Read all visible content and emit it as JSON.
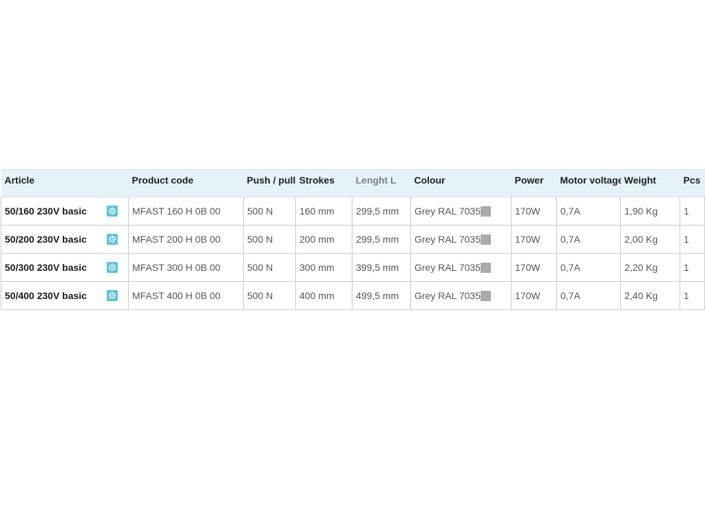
{
  "table": {
    "headers": {
      "article": "Article",
      "product_code": "Product code",
      "push_pull": "Push / pull",
      "strokes": "Strokes",
      "length": "Lenght L",
      "colour": "Colour",
      "power": "Power",
      "motor_voltage": "Motor voltage",
      "weight": "Weight",
      "pcs": "Pcs"
    },
    "swatch_color": "#aaaaaa",
    "icon_color": "#5bc3d8",
    "row_icon": "configurator-icon",
    "rows": [
      {
        "article": "50/160 230V basic",
        "product_code": "MFAST 160 H 0B 00",
        "push_pull": "500 N",
        "strokes": "160 mm",
        "length": "299,5 mm",
        "colour": "Grey RAL 7035",
        "power": "170W",
        "motor_voltage": "0,7A",
        "weight": "1,90 Kg",
        "pcs": "1"
      },
      {
        "article": "50/200 230V basic",
        "product_code": "MFAST 200 H 0B 00",
        "push_pull": "500 N",
        "strokes": "200 mm",
        "length": "299,5 mm",
        "colour": "Grey RAL 7035",
        "power": "170W",
        "motor_voltage": "0,7A",
        "weight": "2,00 Kg",
        "pcs": "1"
      },
      {
        "article": "50/300 230V basic",
        "product_code": "MFAST 300 H 0B 00",
        "push_pull": "500 N",
        "strokes": "300 mm",
        "length": "399,5 mm",
        "colour": "Grey RAL 7035",
        "power": "170W",
        "motor_voltage": "0,7A",
        "weight": "2,20 Kg",
        "pcs": "1"
      },
      {
        "article": "50/400 230V basic",
        "product_code": "MFAST 400 H 0B 00",
        "push_pull": "500 N",
        "strokes": "400 mm",
        "length": "499,5 mm",
        "colour": "Grey RAL 7035",
        "power": "170W",
        "motor_voltage": "0,7A",
        "weight": "2,40 Kg",
        "pcs": "1"
      }
    ]
  }
}
